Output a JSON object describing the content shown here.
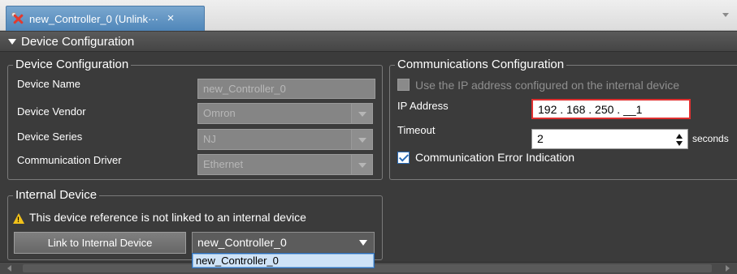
{
  "tab": {
    "title": "new_Controller_0 (Unlink···",
    "close_glyph": "×"
  },
  "section": {
    "title": "Device Configuration"
  },
  "device_config": {
    "group_title": "Device Configuration",
    "device_name_label": "Device Name",
    "device_name_value": "new_Controller_0",
    "device_vendor_label": "Device Vendor",
    "device_vendor_value": "Omron",
    "device_series_label": "Device Series",
    "device_series_value": "NJ",
    "comm_driver_label": "Communication Driver",
    "comm_driver_value": "Ethernet"
  },
  "comm_config": {
    "group_title": "Communications Configuration",
    "use_ip_label": "Use the IP address configured on the internal device",
    "use_ip_checked": false,
    "ip_label": "IP Address",
    "ip_value": "192 . 168 . 250 . __1",
    "timeout_label": "Timeout",
    "timeout_value": "2",
    "timeout_unit": "seconds",
    "comm_error_label": "Communication Error Indication",
    "comm_error_checked": true
  },
  "internal_device": {
    "group_title": "Internal Device",
    "warning_text": "This device reference is not linked to an internal device",
    "link_button_label": "Link to Internal Device",
    "selected_device": "new_Controller_0",
    "dropdown_options": [
      "new_Controller_0"
    ]
  },
  "colors": {
    "accent": "#2a6cb8",
    "tab_blue": "#4f86b9",
    "error_border": "#e03030",
    "warning": "#f2c21a",
    "panel_bg": "#3b3b3b"
  },
  "icons": {
    "tab": "offline-controller-icon",
    "tab_close": "close-icon",
    "section_caret": "caret-down-icon",
    "warning": "warning-icon",
    "dropdown": "chevron-down-icon",
    "spinner": "spinner-icon"
  }
}
